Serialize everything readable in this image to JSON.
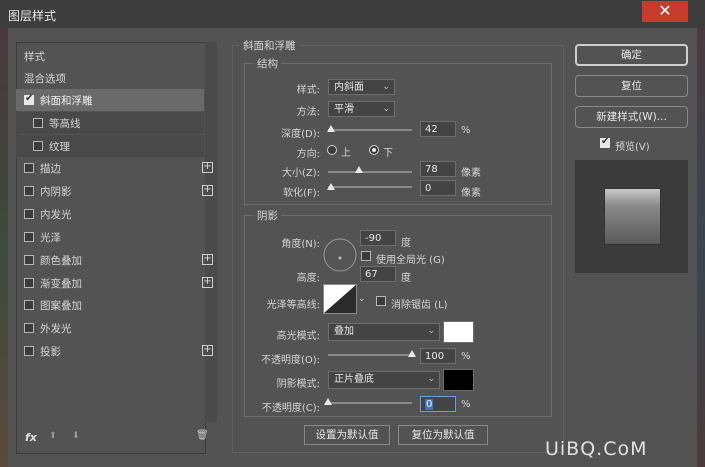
{
  "window": {
    "title": "图层样式",
    "close_glyph": "✕"
  },
  "left_panel": {
    "items": [
      {
        "label": "样式"
      },
      {
        "label": "混合选项"
      },
      {
        "label": "斜面和浮雕",
        "checked": true,
        "selected": true
      },
      {
        "label": "等高线",
        "checked": false,
        "sub": true
      },
      {
        "label": "纹理",
        "checked": false,
        "sub": true
      },
      {
        "label": "描边",
        "checked": false,
        "plus": true
      },
      {
        "label": "内阴影",
        "checked": false,
        "plus": true
      },
      {
        "label": "内发光",
        "checked": false
      },
      {
        "label": "光泽",
        "checked": false
      },
      {
        "label": "颜色叠加",
        "checked": false,
        "plus": true
      },
      {
        "label": "渐变叠加",
        "checked": false,
        "plus": true
      },
      {
        "label": "图案叠加",
        "checked": false
      },
      {
        "label": "外发光",
        "checked": false
      },
      {
        "label": "投影",
        "checked": false,
        "plus": true
      }
    ],
    "bottom": {
      "fx": "fx",
      "up": "⬆",
      "down": "⬇",
      "trash": "🗑"
    }
  },
  "bevel": {
    "section_title": "斜面和浮雕",
    "structure": {
      "title": "结构",
      "style_label": "样式:",
      "style_value": "内斜面",
      "technique_label": "方法:",
      "technique_value": "平滑",
      "depth_label": "深度(D):",
      "depth_value": "42",
      "depth_unit": "%",
      "direction_label": "方向:",
      "dir_up": "上",
      "dir_down": "下",
      "size_label": "大小(Z):",
      "size_value": "78",
      "size_unit": "像素",
      "soften_label": "软化(F):",
      "soften_value": "0",
      "soften_unit": "像素"
    },
    "shading": {
      "title": "阴影",
      "angle_label": "角度(N):",
      "angle_value": "-90",
      "angle_unit": "度",
      "global_light_label": "使用全局光 (G)",
      "altitude_label": "高度:",
      "altitude_value": "67",
      "altitude_unit": "度",
      "gloss_label": "光泽等高线:",
      "antialias_label": "消除锯齿 (L)",
      "highlight_label": "高光模式:",
      "highlight_value": "叠加",
      "highlight_color": "#ffffff",
      "hopacity_label": "不透明度(O):",
      "hopacity_value": "100",
      "hopacity_unit": "%",
      "shadow_label": "阴影模式:",
      "shadow_value": "正片叠底",
      "shadow_color": "#000000",
      "sopacity_label": "不透明度(C):",
      "sopacity_value": "0",
      "sopacity_unit": "%"
    },
    "make_default": "设置为默认值",
    "reset_default": "复位为默认值"
  },
  "right": {
    "ok": "确定",
    "reset": "复位",
    "new_style": "新建样式(W)...",
    "preview_label": "预览(V)"
  },
  "watermark": "UiBQ.CoM"
}
